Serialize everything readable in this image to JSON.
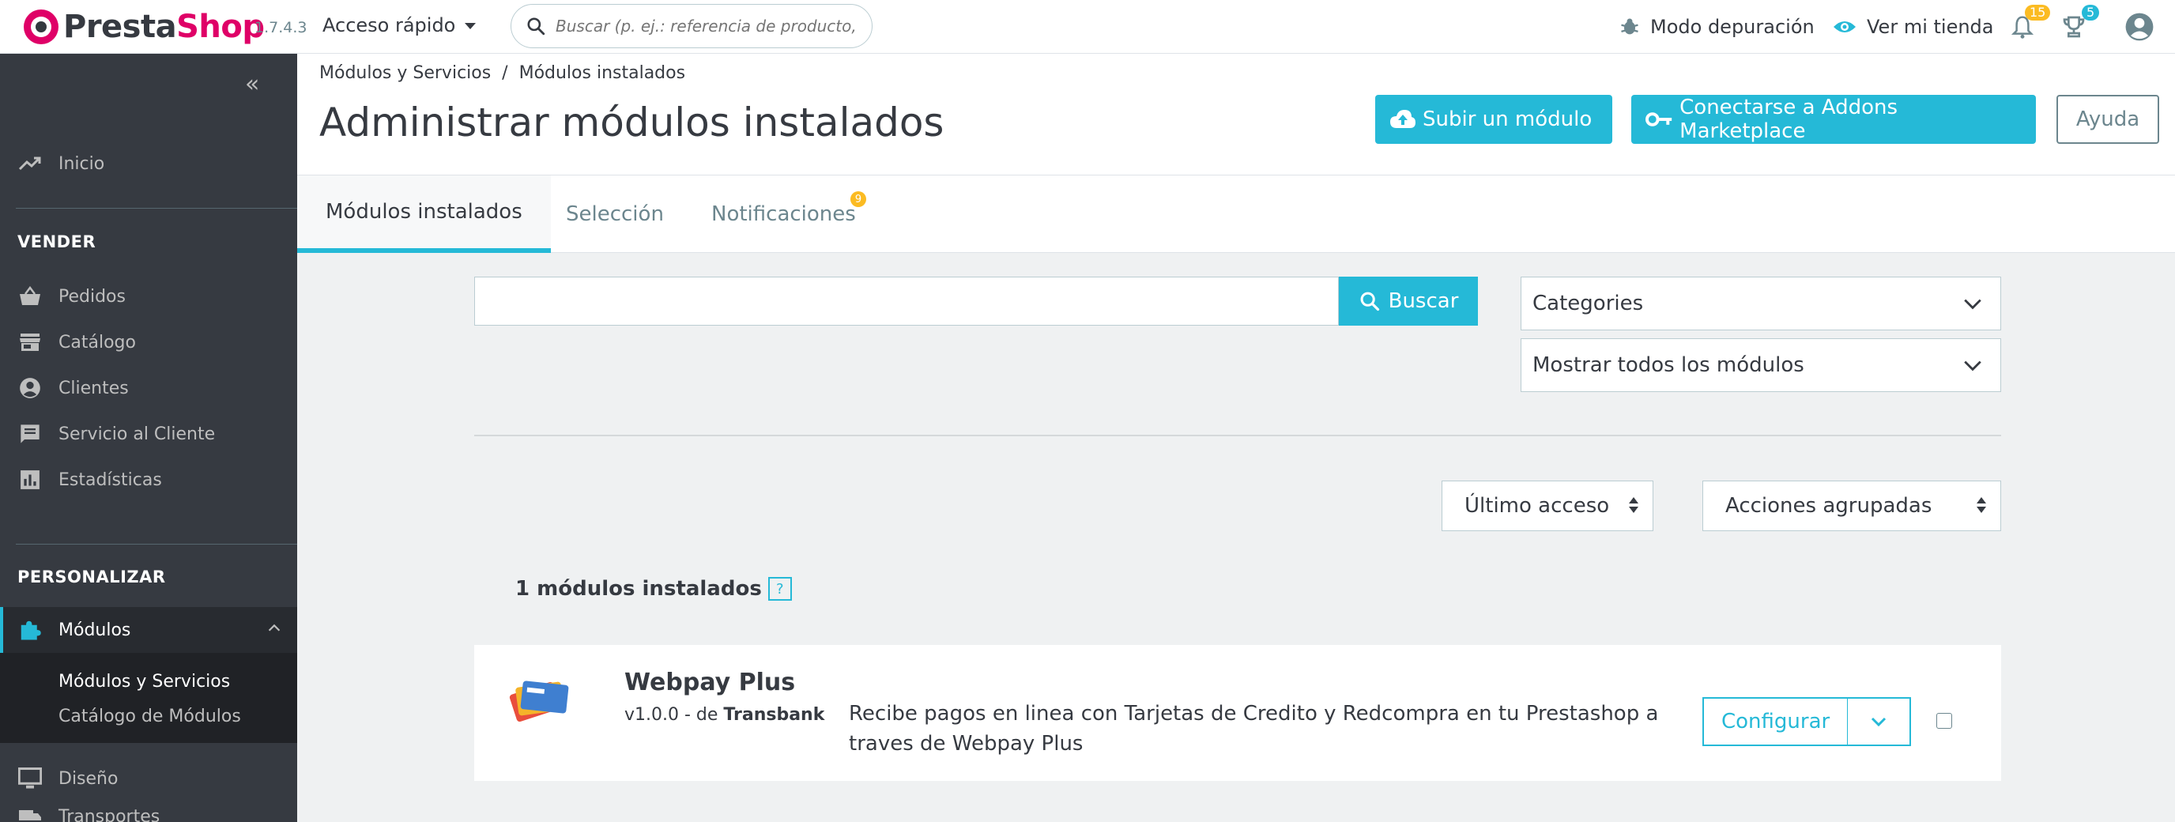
{
  "header": {
    "brand_part1": "Presta",
    "brand_part2": "Shop",
    "version": "1.7.4.3",
    "quick_access": "Acceso rápido",
    "search_placeholder": "Buscar (p. ej.: referencia de producto, no",
    "debug_mode": "Modo depuración",
    "view_store": "Ver mi tienda",
    "notifications_count": "15",
    "trophy_count": "5"
  },
  "sidebar": {
    "inicio": "Inicio",
    "section_sell": "VENDER",
    "sell_items": [
      "Pedidos",
      "Catálogo",
      "Clientes",
      "Servicio al Cliente",
      "Estadísticas"
    ],
    "section_customize": "PERSONALIZAR",
    "active_item": "Módulos",
    "sub_items": [
      "Módulos y Servicios",
      "Catálogo de Módulos"
    ],
    "design": "Diseño",
    "partial_item": "Transportes"
  },
  "page": {
    "breadcrumb": "Módulos y Servicios  /  Módulos instalados",
    "title": "Administrar módulos instalados",
    "btn_upload": "Subir un módulo",
    "btn_addons": "Conectarse a Addons Marketplace",
    "btn_help": "Ayuda"
  },
  "tabs": {
    "installed": "Módulos instalados",
    "selection": "Selección",
    "notifications": "Notificaciones",
    "notifications_badge": "9"
  },
  "filters": {
    "search_button": "Buscar",
    "categories": "Categories",
    "show_all": "Mostrar todos los módulos",
    "sort": "Último acceso",
    "bulk": "Acciones agrupadas"
  },
  "modules": {
    "count_label": "1 módulos instalados",
    "help": "?",
    "item": {
      "name": "Webpay Plus",
      "version_prefix": "v1.0.0 - de ",
      "author": "Transbank",
      "description": "Recibe pagos en linea con Tarjetas de Credito y Redcompra en tu Prestashop a traves de Webpay Plus",
      "configure": "Configurar"
    }
  },
  "colors": {
    "accent": "#25b9d7",
    "brand": "#df0067",
    "sidebar_bg": "#363a41",
    "badge": "#fbbb22"
  }
}
